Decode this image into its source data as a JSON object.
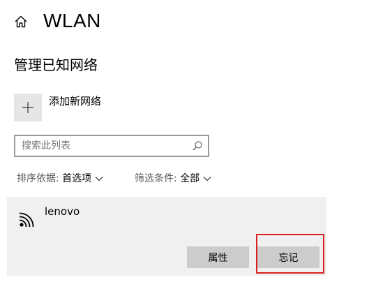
{
  "header": {
    "title": "WLAN",
    "home_icon": "home-icon"
  },
  "section": {
    "title": "管理已知网络"
  },
  "add_network": {
    "label": "添加新网络",
    "icon": "plus-icon"
  },
  "search": {
    "placeholder": "搜索此列表",
    "value": "",
    "icon": "search-icon"
  },
  "sort": {
    "label": "排序依据:",
    "value": "首选项"
  },
  "filter": {
    "label": "筛选条件:",
    "value": "全部"
  },
  "networks": [
    {
      "name": "lenovo",
      "icon": "wifi-icon",
      "properties_label": "属性",
      "forget_label": "忘记"
    }
  ],
  "colors": {
    "panel_bg": "#f0f0f0",
    "button_bg": "#cccccc",
    "highlight": "#d81e1e"
  }
}
